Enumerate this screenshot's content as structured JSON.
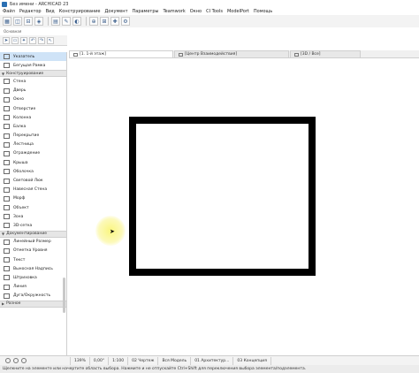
{
  "window": {
    "title": "Без имени - ARCHICAD 23"
  },
  "menu": [
    "Файл",
    "Редактор",
    "Вид",
    "Конструирование",
    "Документ",
    "Параметры",
    "Teamwork",
    "Окно",
    "CI Tools",
    "ModelPort",
    "Помощь"
  ],
  "toolbar": {
    "group_label": "Основная"
  },
  "toolbox": {
    "pointer_items": [
      {
        "label": "Указатель",
        "icon": "arrow-cursor-icon",
        "selected": true
      },
      {
        "label": "Бегущая Рамка",
        "icon": "marquee-icon",
        "selected": false
      }
    ],
    "sections": [
      {
        "title": "Конструирование",
        "items": [
          "Стена",
          "Дверь",
          "Окно",
          "Отверстие",
          "Колонна",
          "Балка",
          "Перекрытие",
          "Лестница",
          "Ограждение",
          "Крыша",
          "Оболочка",
          "Световой Люк",
          "Навесная Стена",
          "Морф",
          "Объект",
          "Зона",
          "3D-сетка"
        ]
      },
      {
        "title": "Документирование",
        "items": [
          "Линейный Размер",
          "Отметка Уровня",
          "Текст",
          "Выносная Надпись",
          "Штриховка",
          "Линия",
          "Дуга/Окружность"
        ]
      }
    ],
    "more_label": "Разное"
  },
  "tabs": [
    {
      "label": "[1. 1-й этаж]",
      "active": true
    },
    {
      "label": "[Центр Взаимодействия]",
      "active": false
    },
    {
      "label": "[3D / Все]",
      "active": false
    }
  ],
  "bottom": {
    "zoom": "139%",
    "angle": "0,00°",
    "scale": "1:100",
    "layer_combo": "02 Чертеж",
    "model_view": "Вся Модель",
    "arch_layer": "01 Архитектур...",
    "concept": "03 Концепция"
  },
  "status": {
    "text": "Щелкните на элементе или начертите область выбора. Нажмите и не отпускайте Ctrl+Shift для переключения выбора элемента/подэлемента."
  },
  "colors": {
    "selection": "#cfe3f7",
    "accent": "#2a6fb3"
  }
}
